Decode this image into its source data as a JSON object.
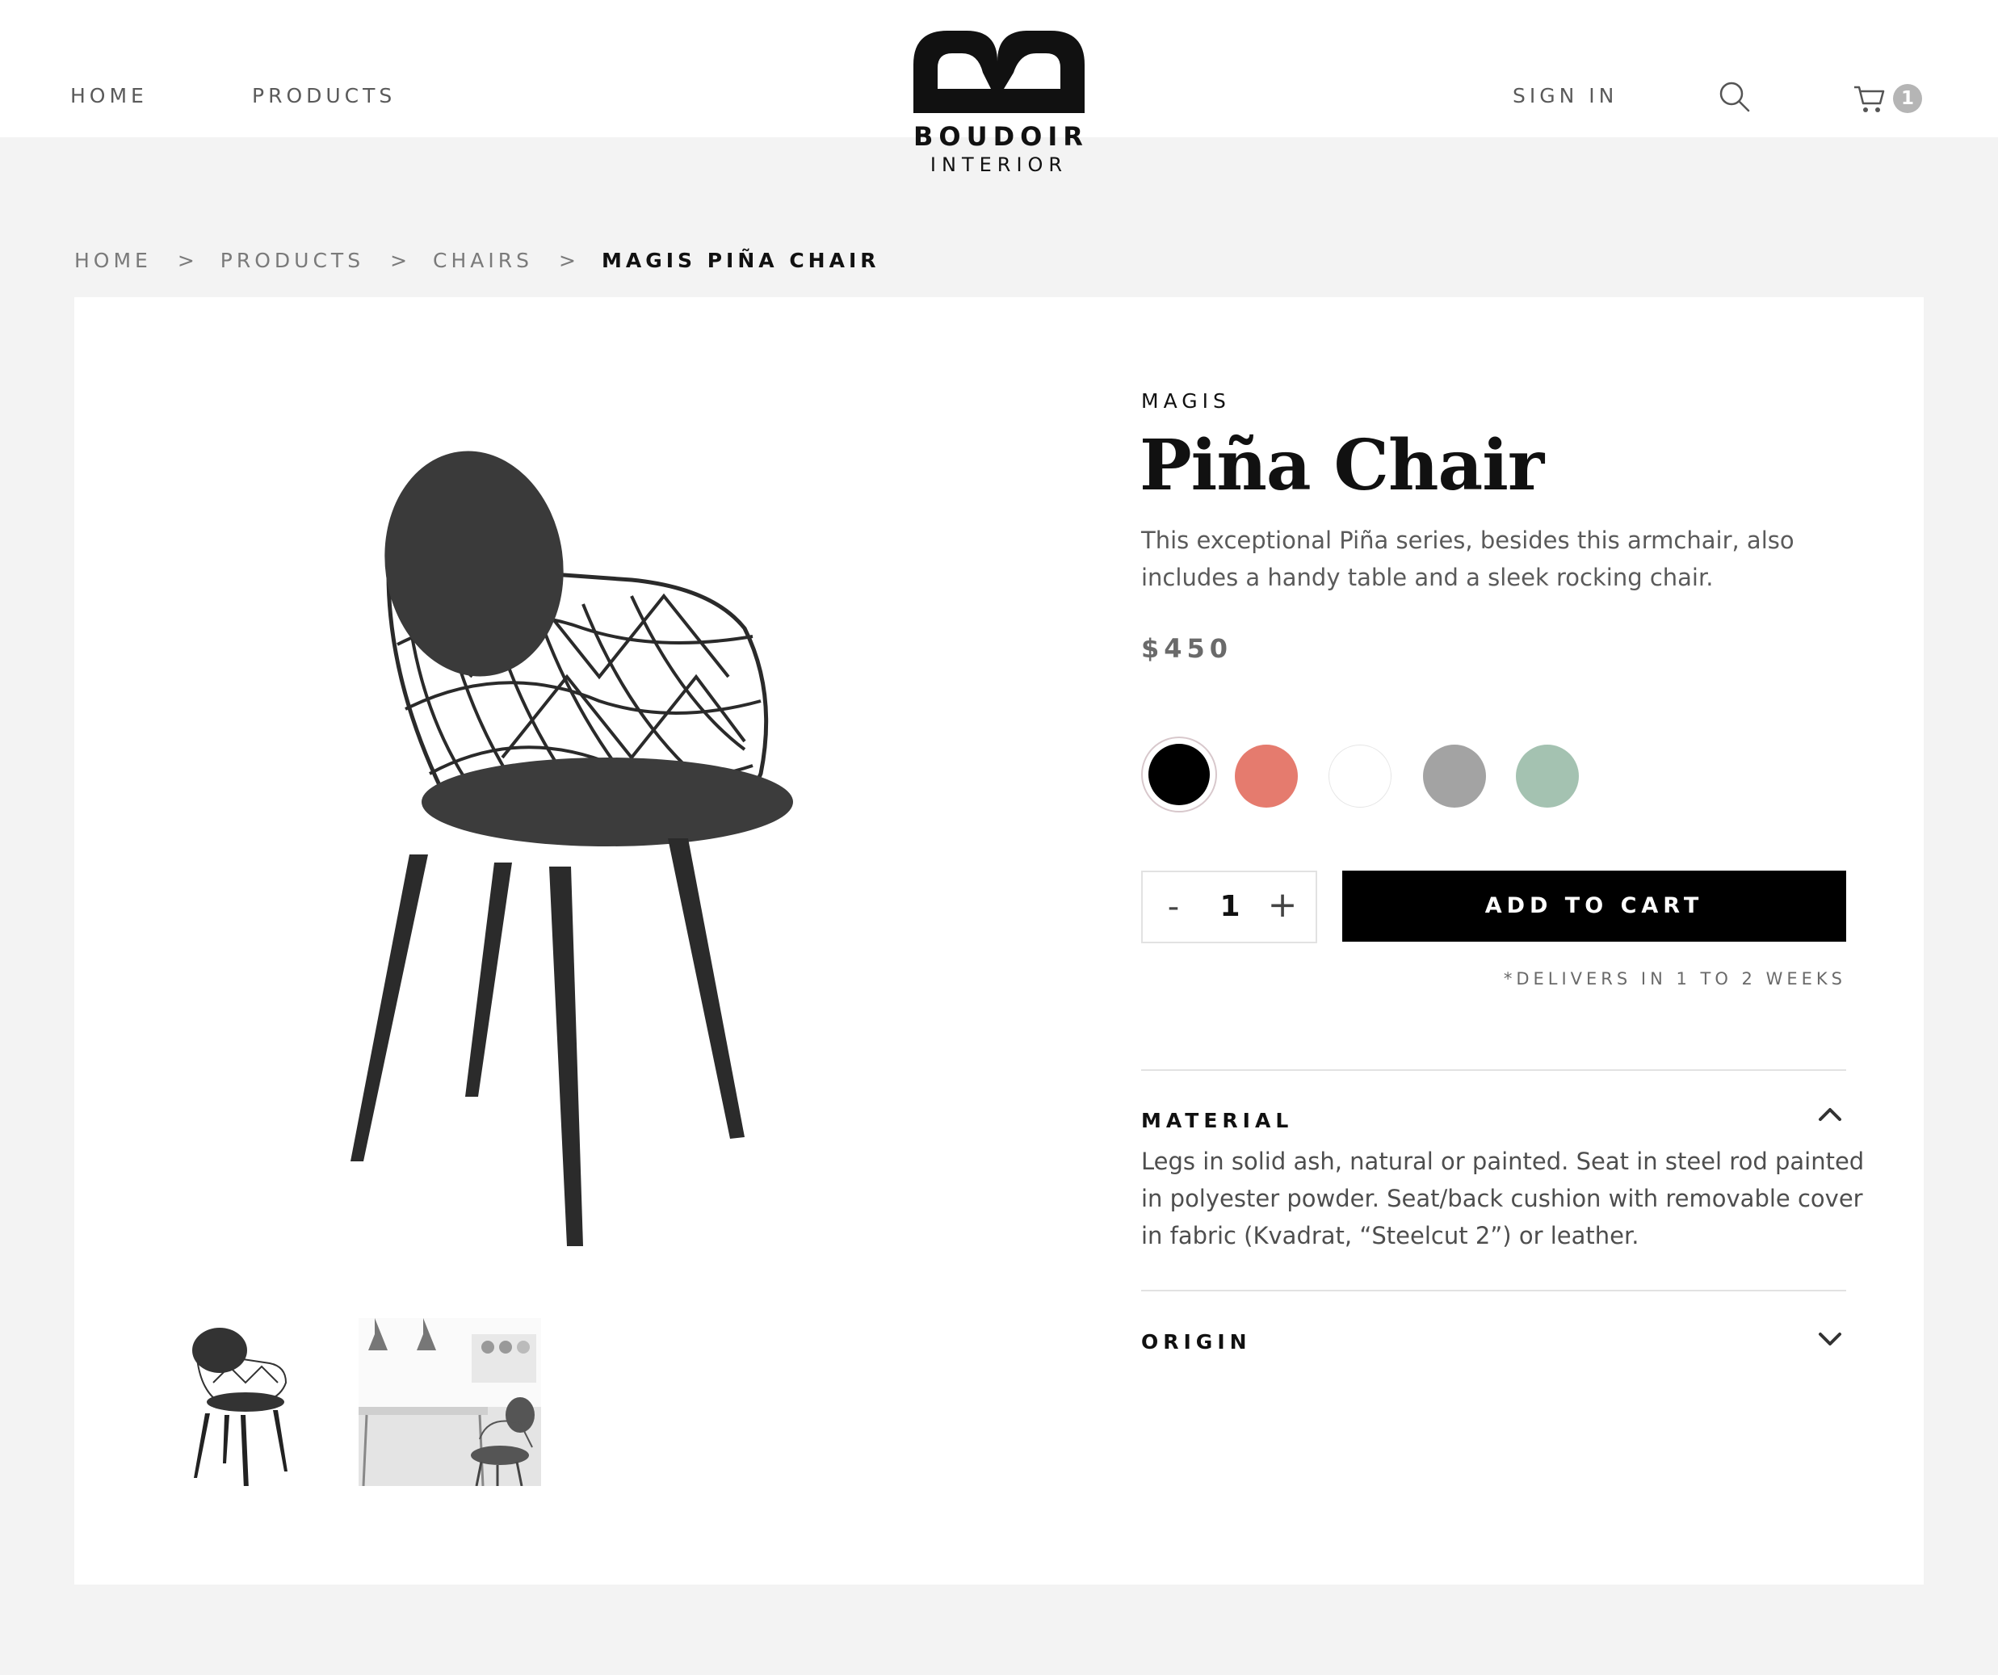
{
  "header": {
    "nav": [
      {
        "label": "HOME"
      },
      {
        "label": "PRODUCTS"
      }
    ],
    "logo": {
      "word": "BOUDOIR",
      "sub": "INTERIOR"
    },
    "sign_in": "SIGN IN",
    "search_icon": "search-icon",
    "cart": {
      "icon": "cart-icon",
      "count": "1"
    }
  },
  "breadcrumb": {
    "items": [
      "HOME",
      "PRODUCTS",
      "CHAIRS"
    ],
    "separator": ">",
    "current": "MAGIS PIÑA CHAIR"
  },
  "product": {
    "brand": "MAGIS",
    "title": "Piña Chair",
    "description": "This exceptional Piña series, besides this armchair, also includes a handy table and a sleek rocking chair.",
    "price": "$450",
    "swatches": [
      {
        "color": "#000000",
        "selected": true
      },
      {
        "color": "#e57b6e",
        "selected": false
      },
      {
        "color": "#ffffff",
        "selected": false
      },
      {
        "color": "#a3a3a3",
        "selected": false
      },
      {
        "color": "#a4c2b1",
        "selected": false
      }
    ],
    "quantity": {
      "minus": "-",
      "value": "1",
      "plus": "+"
    },
    "add_to_cart": "ADD TO CART",
    "delivery_note": "*DELIVERS IN 1 TO 2 WEEKS",
    "accordion": [
      {
        "label": "MATERIAL",
        "expanded": true,
        "icon": "chevron-up-icon",
        "body": "Legs in solid ash, natural or painted. Seat in steel rod painted in polyester powder. Seat/back cushion with removable cover in fabric (Kvadrat, “Steelcut 2”) or leather."
      },
      {
        "label": "ORIGIN",
        "expanded": false,
        "icon": "chevron-down-icon"
      }
    ]
  },
  "colors": {
    "accent": "#000000",
    "page_bg": "#f3f3f3",
    "muted_text": "#5a5a5a"
  }
}
